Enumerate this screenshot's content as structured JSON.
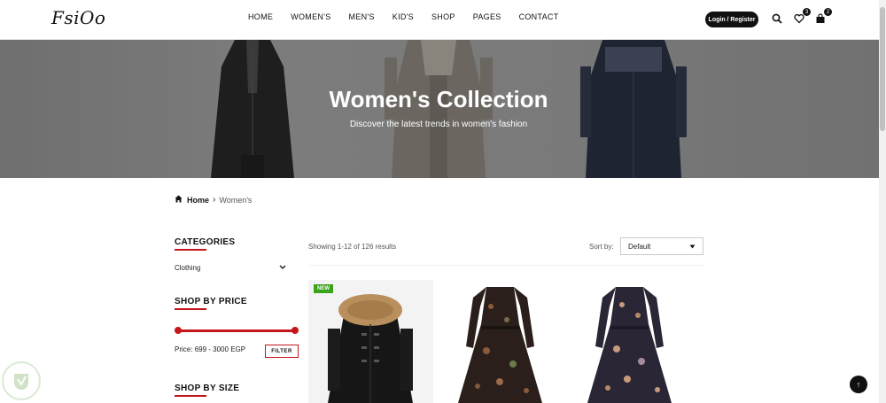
{
  "header": {
    "logo": "FsiOo",
    "nav": [
      "HOME",
      "WOMEN'S",
      "MEN'S",
      "KID'S",
      "SHOP",
      "PAGES",
      "CONTACT"
    ],
    "login_label": "Login / Register",
    "wishlist_count": "3",
    "cart_count": "2"
  },
  "hero": {
    "title": "Women's Collection",
    "subtitle": "Discover the latest trends in women's fashion"
  },
  "breadcrumb": {
    "home": "Home",
    "current": "Women's"
  },
  "sidebar": {
    "categories_title": "CATEGORIES",
    "category_item": "Clothing",
    "price_title": "SHOP BY PRICE",
    "price_label": "Price:",
    "price_min": "699",
    "price_max": "3000",
    "price_currency": "EGP",
    "filter_label": "FILTER",
    "size_title": "SHOP BY SIZE"
  },
  "listing": {
    "results": "Showing 1-12 of 126 results",
    "sort_label": "Sort by:",
    "sort_value": "Default",
    "new_badge": "NEW"
  },
  "colors": {
    "accent": "#c4161c",
    "new_badge": "#3aa31c",
    "dark": "#111111"
  }
}
